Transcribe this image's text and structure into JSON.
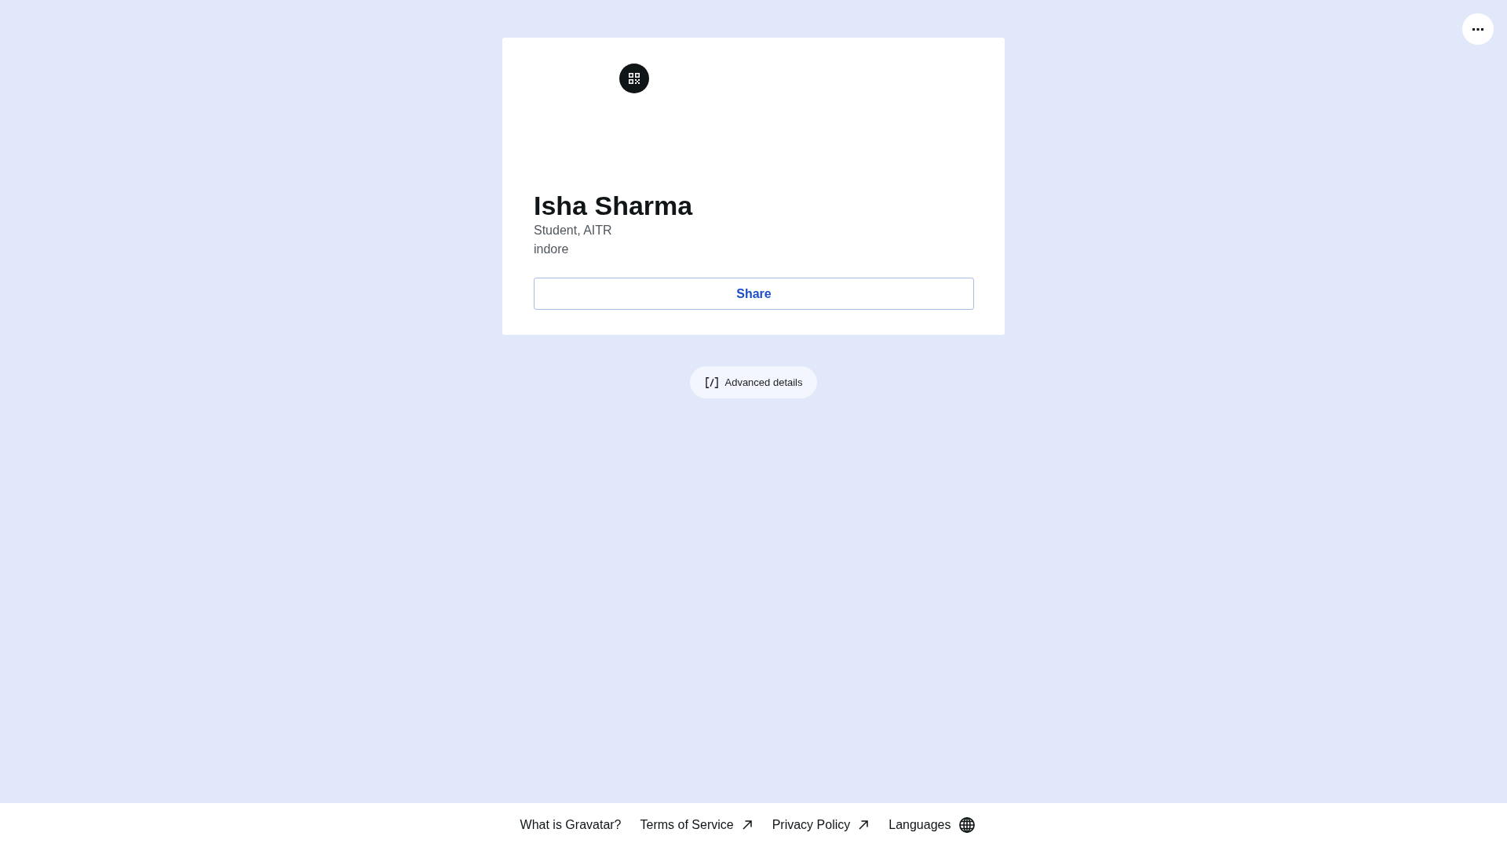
{
  "profile_card": {
    "name": "Isha Sharma",
    "details": [
      "Student, AITR",
      "indore"
    ],
    "share_button": "Share"
  },
  "advanced_details_button": "Advanced details",
  "footer": {
    "links": [
      {
        "label": "What is Gravatar?",
        "kind": "plain"
      },
      {
        "label": "Terms of Service",
        "kind": "external"
      },
      {
        "label": "Privacy Policy",
        "kind": "external"
      },
      {
        "label": "Languages",
        "kind": "language"
      }
    ]
  }
}
